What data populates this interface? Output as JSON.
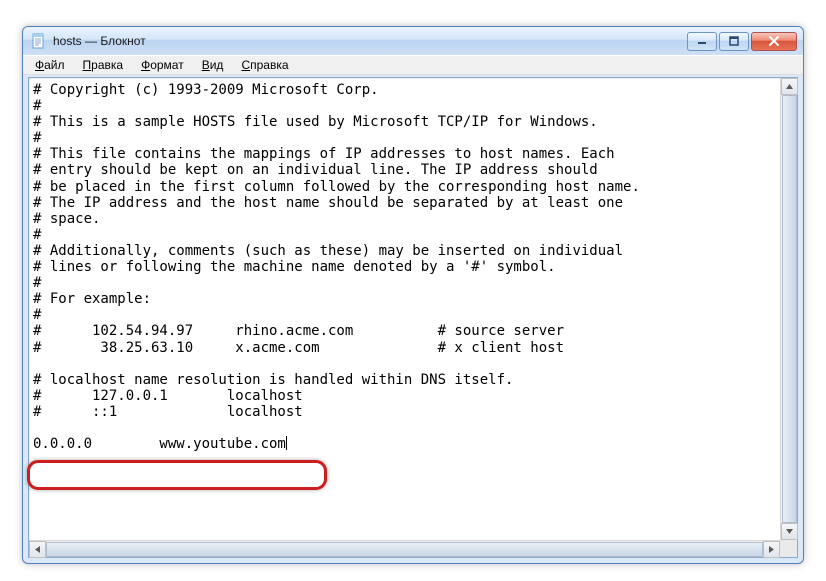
{
  "window": {
    "title": "hosts — Блокнот"
  },
  "menu": {
    "items": [
      {
        "label": "Файл"
      },
      {
        "label": "Правка"
      },
      {
        "label": "Формат"
      },
      {
        "label": "Вид"
      },
      {
        "label": "Справка"
      }
    ]
  },
  "text": {
    "lines": [
      "# Copyright (c) 1993-2009 Microsoft Corp.",
      "#",
      "# This is a sample HOSTS file used by Microsoft TCP/IP for Windows.",
      "#",
      "# This file contains the mappings of IP addresses to host names. Each",
      "# entry should be kept on an individual line. The IP address should",
      "# be placed in the first column followed by the corresponding host name.",
      "# The IP address and the host name should be separated by at least one",
      "# space.",
      "#",
      "# Additionally, comments (such as these) may be inserted on individual",
      "# lines or following the machine name denoted by a '#' symbol.",
      "#",
      "# For example:",
      "#",
      "#      102.54.94.97     rhino.acme.com          # source server",
      "#       38.25.63.10     x.acme.com              # x client host",
      "",
      "# localhost name resolution is handled within DNS itself.",
      "#      127.0.0.1       localhost",
      "#      ::1             localhost",
      "",
      "0.0.0.0        www.youtube.com"
    ]
  }
}
